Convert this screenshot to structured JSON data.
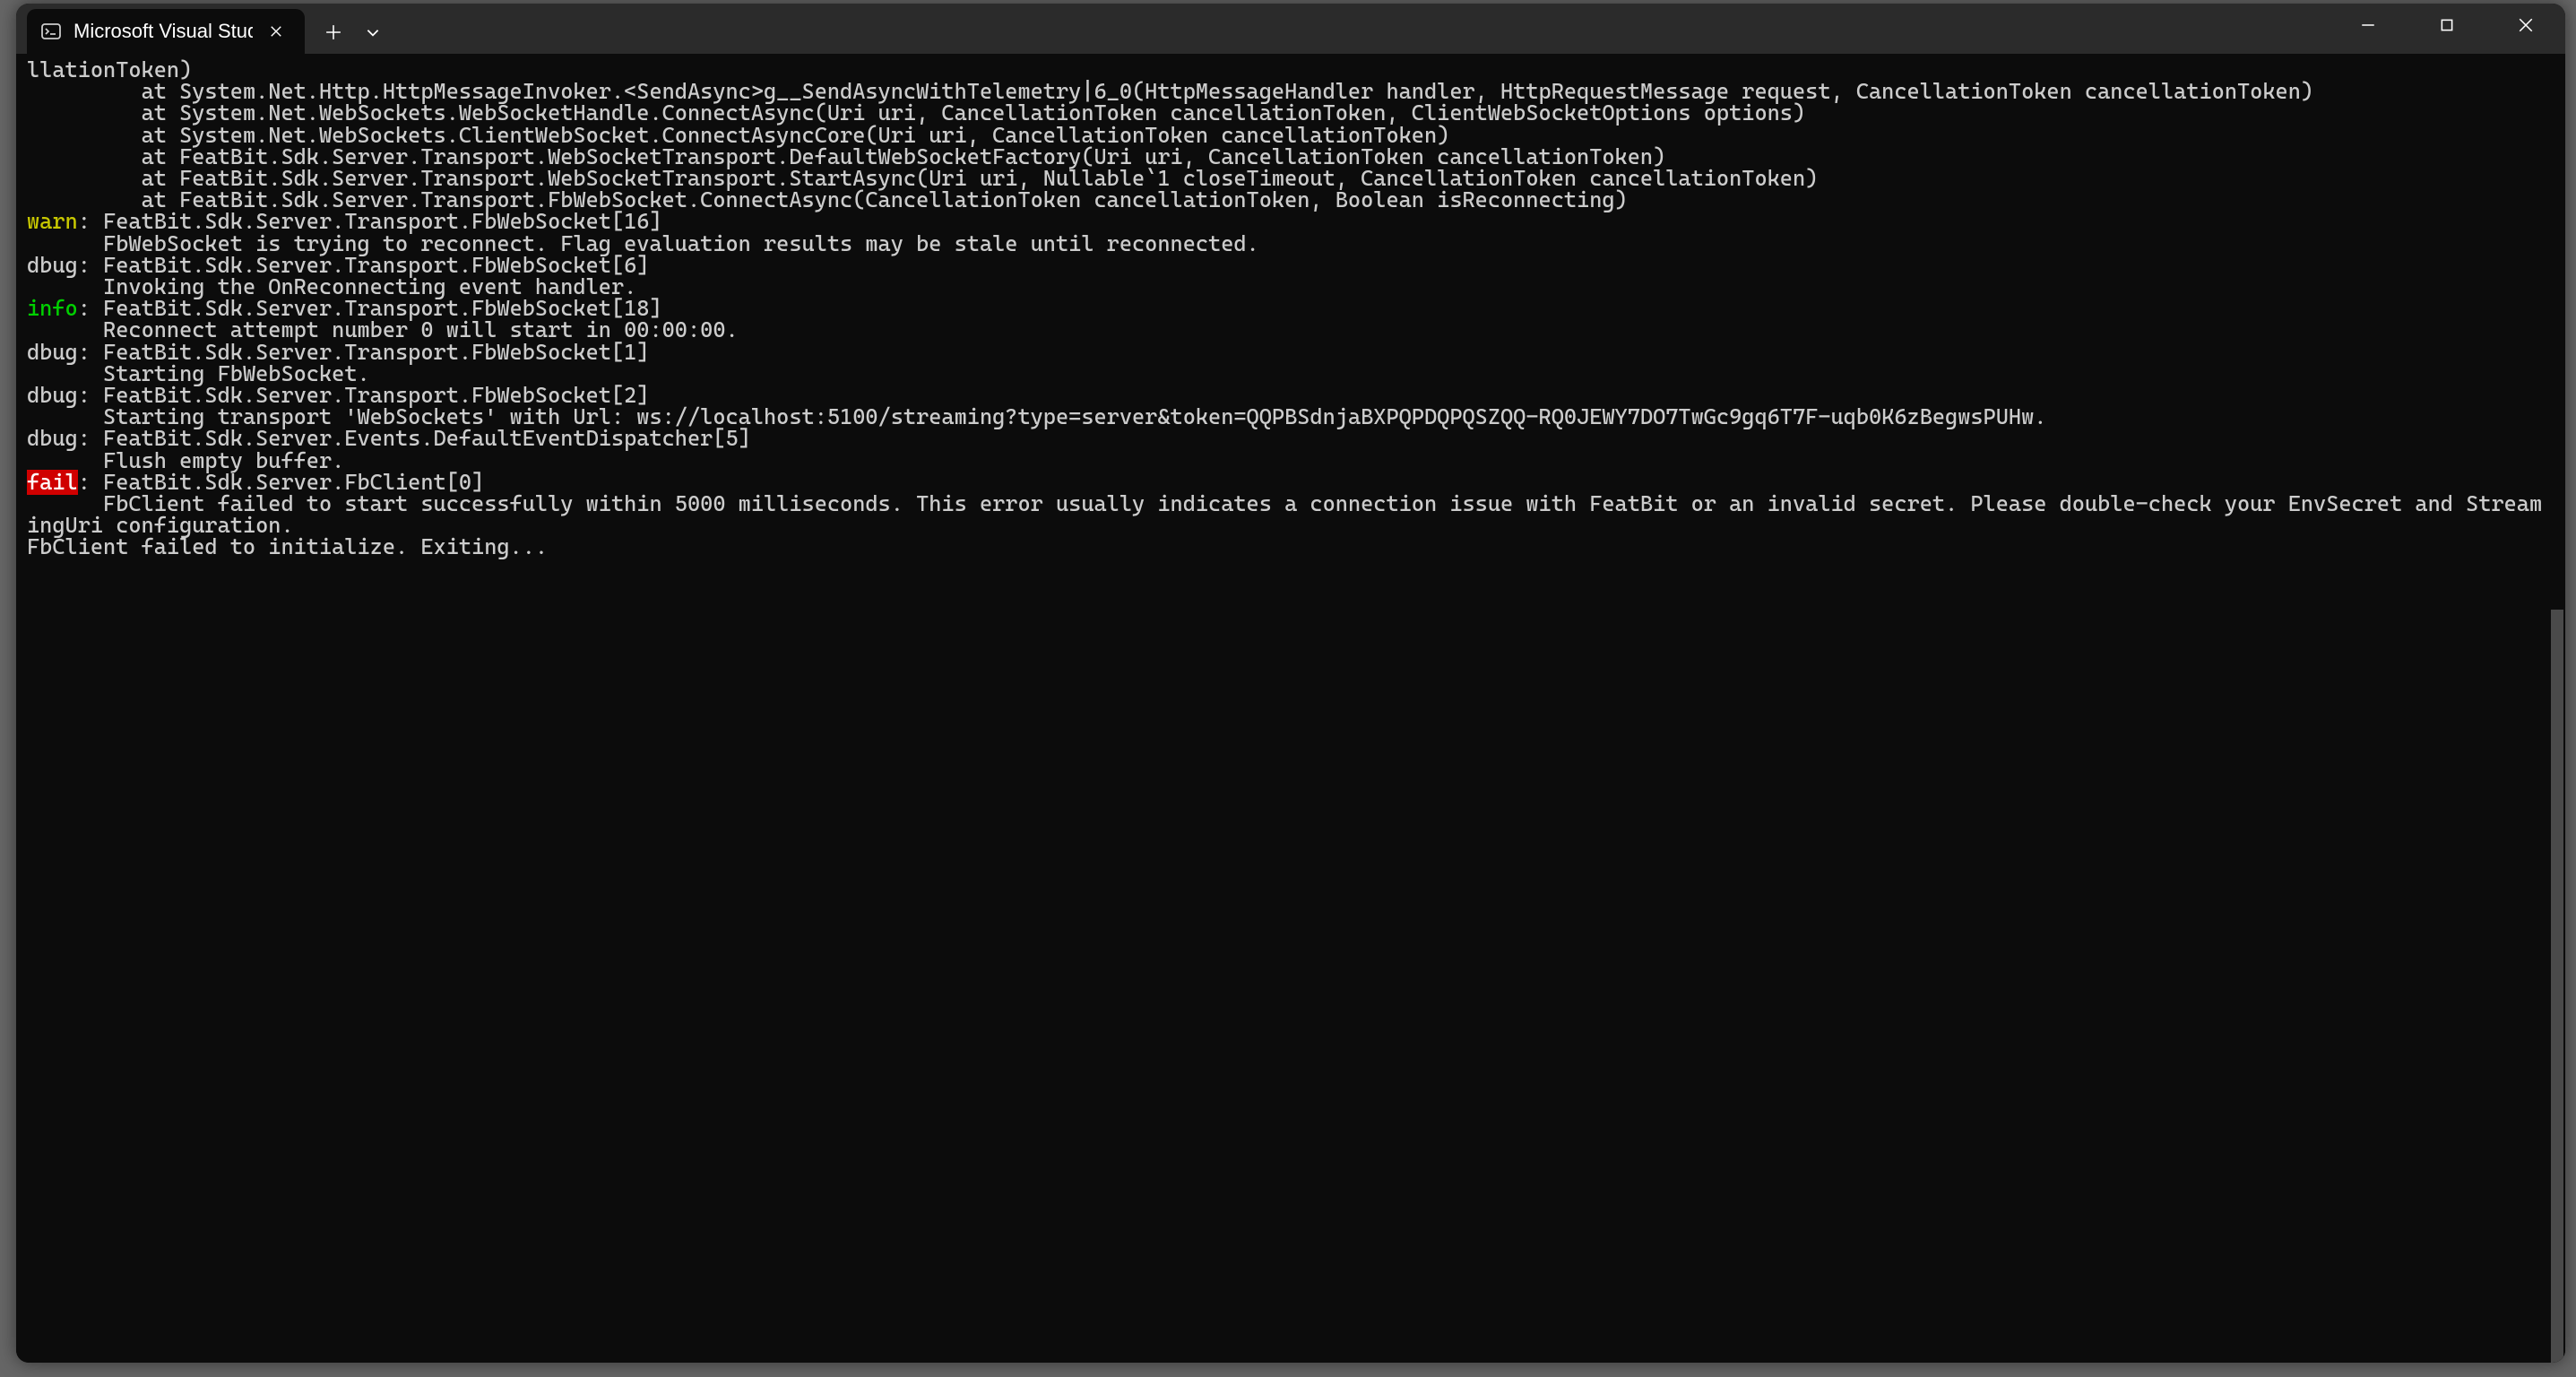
{
  "window": {
    "tab_title": "Microsoft Visual Studio Debug"
  },
  "log": {
    "stack_lines": [
      "llationToken)",
      "         at System.Net.Http.HttpMessageInvoker.<SendAsync>g__SendAsyncWithTelemetry|6_0(HttpMessageHandler handler, HttpRequestMessage request, CancellationToken cancellationToken)",
      "         at System.Net.WebSockets.WebSocketHandle.ConnectAsync(Uri uri, CancellationToken cancellationToken, ClientWebSocketOptions options)",
      "         at System.Net.WebSockets.ClientWebSocket.ConnectAsyncCore(Uri uri, CancellationToken cancellationToken)",
      "         at FeatBit.Sdk.Server.Transport.WebSocketTransport.DefaultWebSocketFactory(Uri uri, CancellationToken cancellationToken)",
      "         at FeatBit.Sdk.Server.Transport.WebSocketTransport.StartAsync(Uri uri, Nullable`1 closeTimeout, CancellationToken cancellationToken)",
      "         at FeatBit.Sdk.Server.Transport.FbWebSocket.ConnectAsync(CancellationToken cancellationToken, Boolean isReconnecting)"
    ],
    "entries": [
      {
        "level": "warn",
        "source": "FeatBit.Sdk.Server.Transport.FbWebSocket[16]",
        "message": "FbWebSocket is trying to reconnect. Flag evaluation results may be stale until reconnected."
      },
      {
        "level": "dbug",
        "source": "FeatBit.Sdk.Server.Transport.FbWebSocket[6]",
        "message": "Invoking the OnReconnecting event handler."
      },
      {
        "level": "info",
        "source": "FeatBit.Sdk.Server.Transport.FbWebSocket[18]",
        "message": "Reconnect attempt number 0 will start in 00:00:00."
      },
      {
        "level": "dbug",
        "source": "FeatBit.Sdk.Server.Transport.FbWebSocket[1]",
        "message": "Starting FbWebSocket."
      },
      {
        "level": "dbug",
        "source": "FeatBit.Sdk.Server.Transport.FbWebSocket[2]",
        "message": "Starting transport 'WebSockets' with Url: ws://localhost:5100/streaming?type=server&token=QQPBSdnjaBXPQPDQPQSZQQ-RQ0JEWY7DO7TwGc9gq6T7F-uqb0K6zBegwsPUHw."
      },
      {
        "level": "dbug",
        "source": "FeatBit.Sdk.Server.Events.DefaultEventDispatcher[5]",
        "message": "Flush empty buffer."
      },
      {
        "level": "fail",
        "source": "FeatBit.Sdk.Server.FbClient[0]",
        "message": "FbClient failed to start successfully within 5000 milliseconds. This error usually indicates a connection issue with FeatBit or an invalid secret. Please double-check your EnvSecret and StreamingUri configuration."
      }
    ],
    "trailing": "FbClient failed to initialize. Exiting..."
  }
}
